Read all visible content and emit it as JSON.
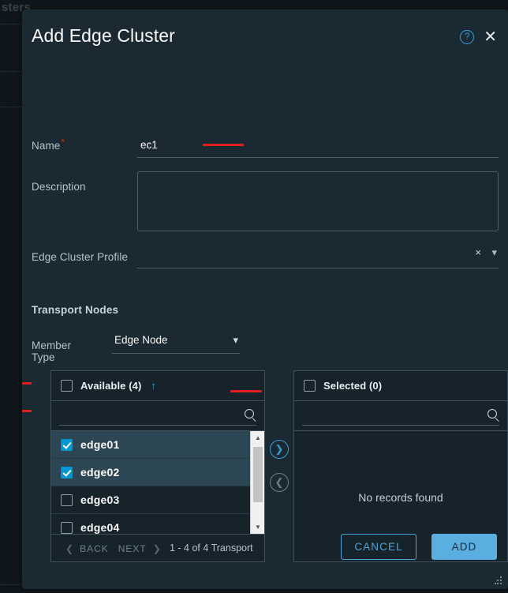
{
  "background": {
    "page_title_partial": "sters"
  },
  "modal": {
    "title": "Add Edge Cluster",
    "help_icon": "help-circle-icon",
    "close_icon": "close-icon",
    "resize_grip": "resize-grip-icon"
  },
  "form": {
    "name": {
      "label": "Name",
      "required_marker": "*",
      "value": "ec1",
      "placeholder": ""
    },
    "description": {
      "label": "Description",
      "value": "",
      "placeholder": ""
    },
    "edge_cluster_profile": {
      "label": "Edge Cluster Profile",
      "value": "",
      "clear_icon": "×",
      "caret_icon": "chevron-down-icon"
    }
  },
  "transport_nodes": {
    "section_title": "Transport Nodes",
    "member_type": {
      "label": "Member Type",
      "value": "Edge Node",
      "caret_icon": "chevron-down-icon",
      "options": [
        "Edge Node"
      ]
    },
    "available": {
      "header_label": "Available (4)",
      "sort_icon": "↑",
      "search_value": "",
      "search_placeholder": "",
      "search_icon": "search-icon",
      "rows": [
        {
          "label": "edge01",
          "checked": true
        },
        {
          "label": "edge02",
          "checked": true
        },
        {
          "label": "edge03",
          "checked": false
        },
        {
          "label": "edge04",
          "checked": false
        }
      ],
      "pagination": {
        "back": "BACK",
        "next": "NEXT",
        "count": "1 - 4 of 4 Transport"
      }
    },
    "selected": {
      "header_label": "Selected (0)",
      "search_value": "",
      "search_placeholder": "",
      "search_icon": "search-icon",
      "empty_message": "No records found"
    },
    "transfer": {
      "move_right_icon": "❯",
      "move_left_icon": "❮"
    }
  },
  "footer": {
    "cancel_label": "CANCEL",
    "add_label": "ADD"
  },
  "colors": {
    "modal_bg": "#1b2a32",
    "page_bg": "#10171c",
    "accent_blue": "#3a9bd4",
    "checkbox_blue": "#0095d3",
    "primary_button": "#5aaee0",
    "selected_row": "#2d4654",
    "required_red": "#e62700",
    "annotation_red": "#e02020",
    "border": "#3f515b"
  }
}
